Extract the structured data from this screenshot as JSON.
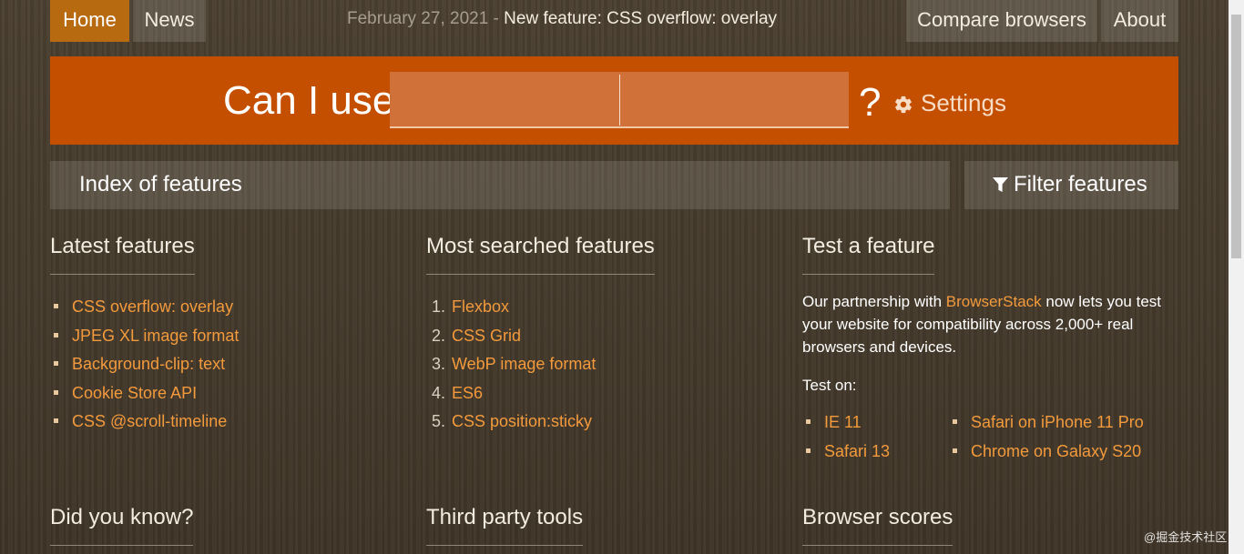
{
  "nav": {
    "home": "Home",
    "news": "News",
    "compare": "Compare browsers",
    "about": "About"
  },
  "news": {
    "date": "February 27, 2021",
    "separator": "-",
    "title": "New feature: CSS overflow: overlay"
  },
  "search": {
    "prefix": "Can I use",
    "value": "",
    "suffix": "?",
    "settings_label": "Settings",
    "settings_icon": "gear-icon"
  },
  "index": {
    "title": "Index of features",
    "filter_label": "Filter features",
    "filter_icon": "funnel-icon"
  },
  "latest": {
    "heading": "Latest features",
    "items": [
      "CSS overflow: overlay",
      "JPEG XL image format",
      "Background-clip: text",
      "Cookie Store API",
      "CSS @scroll-timeline"
    ]
  },
  "most_searched": {
    "heading": "Most searched features",
    "items": [
      {
        "num": "1.",
        "label": "Flexbox"
      },
      {
        "num": "2.",
        "label": "CSS Grid"
      },
      {
        "num": "3.",
        "label": "WebP image format"
      },
      {
        "num": "4.",
        "label": "ES6"
      },
      {
        "num": "5.",
        "label": "CSS position:sticky"
      }
    ]
  },
  "test": {
    "heading": "Test a feature",
    "para_before": "Our partnership with ",
    "para_link": "BrowserStack",
    "para_after": " now lets you test your website for compatibility across 2,000+ real browsers and devices.",
    "test_on": "Test on:",
    "left_items": [
      "IE 11",
      "Safari 13"
    ],
    "right_items": [
      "Safari on iPhone 11 Pro",
      "Chrome on Galaxy S20"
    ]
  },
  "bottom": {
    "did_you_know": "Did you know?",
    "third_party": "Third party tools",
    "browser_scores": "Browser scores"
  },
  "watermark": "@掘金技术社区",
  "colors": {
    "accent": "#c44f00",
    "active_nav": "#b86a10",
    "link": "#f39a3c"
  }
}
